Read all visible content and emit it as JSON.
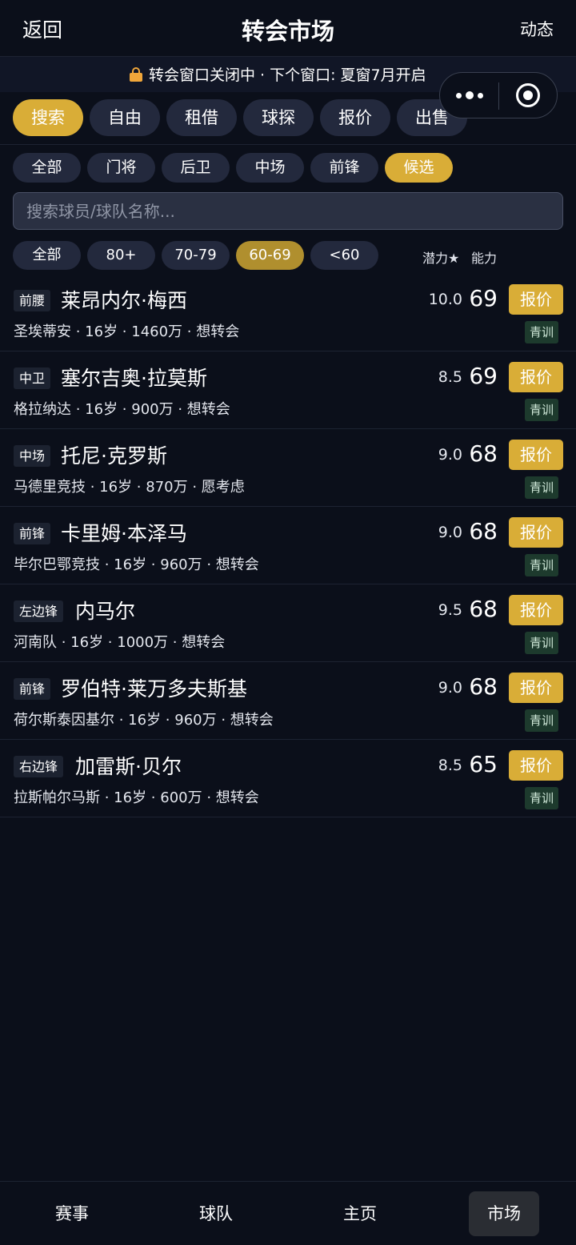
{
  "header": {
    "back": "返回",
    "title": "转会市场",
    "right": "动态"
  },
  "banner": {
    "text": "转会窗口关闭中 · 下个窗口: 夏窗7月开启",
    "icon": "lock-icon",
    "icon_color": "#f0a63a"
  },
  "capsule": {
    "more_icon": "more-dots-icon",
    "close_icon": "target-close-icon"
  },
  "tabs": [
    "搜索",
    "自由",
    "租借",
    "球探",
    "报价",
    "出售"
  ],
  "positions": [
    "全部",
    "门将",
    "后卫",
    "中场",
    "前锋",
    "候选"
  ],
  "search": {
    "placeholder": "搜索球员/球队名称..."
  },
  "ratings": [
    "全部",
    "80+",
    "70-79",
    "60-69",
    "<60"
  ],
  "sort": {
    "potential": "潜力★",
    "ability": "能力"
  },
  "accent_color": "#d9ad37",
  "players": [
    {
      "pos": "前腰",
      "name": "莱昂内尔·梅西",
      "club": "圣埃蒂安",
      "age": "16岁",
      "value": "1460万",
      "status": "想转会",
      "potential": "10.0",
      "ability": "69",
      "offer": "报价",
      "tag": "青训"
    },
    {
      "pos": "中卫",
      "name": "塞尔吉奥·拉莫斯",
      "club": "格拉纳达",
      "age": "16岁",
      "value": "900万",
      "status": "想转会",
      "potential": "8.5",
      "ability": "69",
      "offer": "报价",
      "tag": "青训"
    },
    {
      "pos": "中场",
      "name": "托尼·克罗斯",
      "club": "马德里竞技",
      "age": "16岁",
      "value": "870万",
      "status": "愿考虑",
      "potential": "9.0",
      "ability": "68",
      "offer": "报价",
      "tag": "青训"
    },
    {
      "pos": "前锋",
      "name": "卡里姆·本泽马",
      "club": "毕尔巴鄂竞技",
      "age": "16岁",
      "value": "960万",
      "status": "想转会",
      "potential": "9.0",
      "ability": "68",
      "offer": "报价",
      "tag": "青训"
    },
    {
      "pos": "左边锋",
      "name": "内马尔",
      "club": "河南队",
      "age": "16岁",
      "value": "1000万",
      "status": "想转会",
      "potential": "9.5",
      "ability": "68",
      "offer": "报价",
      "tag": "青训"
    },
    {
      "pos": "前锋",
      "name": "罗伯特·莱万多夫斯基",
      "club": "荷尔斯泰因基尔",
      "age": "16岁",
      "value": "960万",
      "status": "想转会",
      "potential": "9.0",
      "ability": "68",
      "offer": "报价",
      "tag": "青训"
    },
    {
      "pos": "右边锋",
      "name": "加雷斯·贝尔",
      "club": "拉斯帕尔马斯",
      "age": "16岁",
      "value": "600万",
      "status": "想转会",
      "potential": "8.5",
      "ability": "65",
      "offer": "报价",
      "tag": "青训"
    }
  ],
  "nav": [
    "赛事",
    "球队",
    "主页",
    "市场"
  ]
}
